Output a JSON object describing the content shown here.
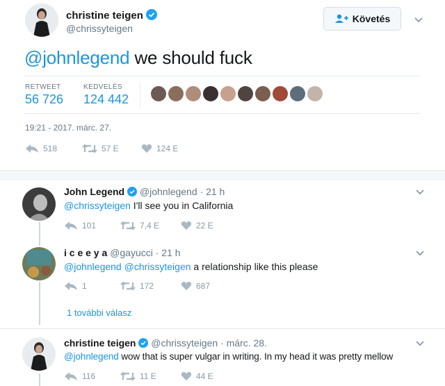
{
  "main_tweet": {
    "display_name": "christine teigen",
    "handle": "@chrissyteigen",
    "follow_label": "Követés",
    "text_mention": "@johnlegend",
    "text_body": " we should fuck",
    "stats": {
      "retweet_label": "RETWEET",
      "retweet_count": "56 726",
      "like_label": "KEDVELÉS",
      "like_count": "124 442"
    },
    "timestamp": "19:21 - 2017. márc. 27.",
    "actions": {
      "reply": "518",
      "retweet": "57 E",
      "like": "124 E"
    },
    "liker_colors": [
      "#6b5a55",
      "#8a6e5c",
      "#b08c7a",
      "#3a3030",
      "#c7a08f",
      "#4f4440",
      "#7a5e50",
      "#a04a3a",
      "#5d6e7a",
      "#c2b4a8"
    ]
  },
  "replies": [
    {
      "display_name": "John Legend",
      "handle": "@johnlegend",
      "time": "· 21 h",
      "mentions": "@chrissyteigen",
      "text": " I'll see you in California",
      "reply": "101",
      "retweet": "7,4 E",
      "like": "22 E"
    },
    {
      "display_name": "i c e e y a",
      "handle": "@gayucci",
      "time": "· 21 h",
      "mentions": "@johnlegend @chrissyteigen",
      "text": " a relationship like this please",
      "reply": "1",
      "retweet": "172",
      "like": "687"
    },
    {
      "display_name": "christine teigen",
      "handle": "@chrissyteigen",
      "time": "· márc. 28.",
      "mentions": "@johnlegend",
      "text": " wow that is super vulgar in writing. In my head it was pretty mellow",
      "reply": "116",
      "retweet": "11 E",
      "like": "44 E"
    }
  ],
  "more_replies": "1 további válasz",
  "colors": {
    "accent": "#1b95e0",
    "muted": "#8899a6",
    "border": "#e6ecf0"
  }
}
